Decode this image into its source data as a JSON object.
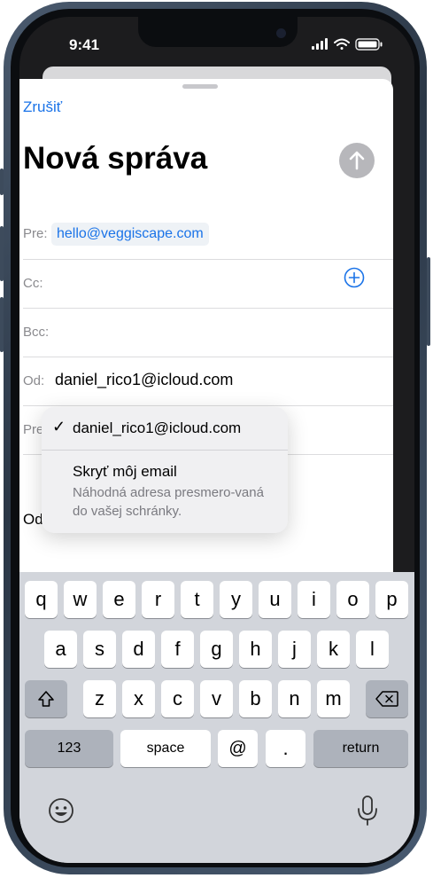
{
  "status_bar": {
    "time": "9:41"
  },
  "compose": {
    "cancel_label": "Zrušiť",
    "title": "Nová správa",
    "to_label": "Pre:",
    "to_value": "hello@veggiscape.com",
    "cc_label": "Cc:",
    "bcc_label": "Bcc:",
    "from_label": "Od:",
    "from_value": "daniel_rico1@icloud.com",
    "subject_label_partial": "Pre",
    "body_label_partial": "Od"
  },
  "from_menu": {
    "checkmark": "✓",
    "option_selected": "daniel_rico1@icloud.com",
    "option_hide_title": "Skryť môj email",
    "option_hide_subtitle": "Náhodná adresa presmero-vaná do vašej schránky."
  },
  "keyboard": {
    "row1": [
      "q",
      "w",
      "e",
      "r",
      "t",
      "y",
      "u",
      "i",
      "o",
      "p"
    ],
    "row2": [
      "a",
      "s",
      "d",
      "f",
      "g",
      "h",
      "j",
      "k",
      "l"
    ],
    "row3": [
      "z",
      "x",
      "c",
      "v",
      "b",
      "n",
      "m"
    ],
    "numbers_label": "123",
    "space_label": "space",
    "at_label": "@",
    "dot_label": ".",
    "return_label": "return"
  },
  "colors": {
    "accent": "#1a73e8",
    "send_disabled": "#b7b7bb"
  }
}
